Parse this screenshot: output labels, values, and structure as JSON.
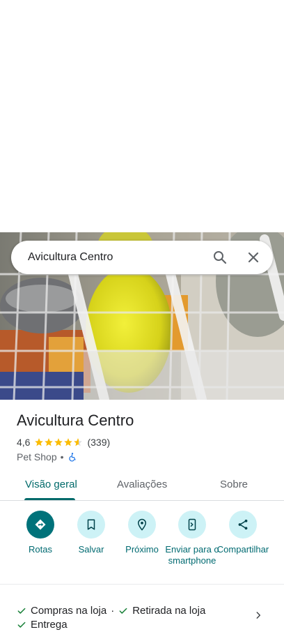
{
  "search": {
    "query": "Avicultura Centro"
  },
  "place": {
    "name": "Avicultura Centro",
    "rating": "4,6",
    "stars_filled": 4.6,
    "review_count": "(339)",
    "category": "Pet Shop",
    "separator": "•",
    "accessibility_icon": "wheelchair-icon"
  },
  "tabs": [
    {
      "label": "Visão geral",
      "active": true
    },
    {
      "label": "Avaliações",
      "active": false
    },
    {
      "label": "Sobre",
      "active": false
    }
  ],
  "actions": [
    {
      "label": "Rotas",
      "icon": "directions-icon"
    },
    {
      "label": "Salvar",
      "icon": "bookmark-icon"
    },
    {
      "label": "Próximo",
      "icon": "nearby-pin-icon"
    },
    {
      "label": "Enviar para o smartphone",
      "icon": "send-to-phone-icon"
    },
    {
      "label": "Compartilhar",
      "icon": "share-icon"
    }
  ],
  "services": {
    "items": [
      "Compras na loja",
      "Retirada na loja",
      "Entrega"
    ],
    "separator": "·"
  },
  "colors": {
    "accent": "#006a6a",
    "action_bg": "#cdf2f6",
    "primary_action": "#00727a",
    "star": "#fbbc04",
    "check": "#188038"
  }
}
